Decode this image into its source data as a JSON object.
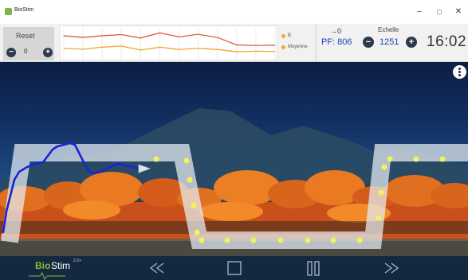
{
  "window": {
    "title": "BioStim",
    "minimize_glyph": "–",
    "maximize_glyph": "□",
    "close_glyph": "✕"
  },
  "reset": {
    "label": "Reset",
    "value": "0",
    "minus_glyph": "−",
    "plus_glyph": "+"
  },
  "chart_data": {
    "type": "line",
    "title": "",
    "xlabel": "",
    "ylabel": "",
    "grid": true,
    "ylim": [
      0,
      100
    ],
    "x": [
      0,
      1,
      2,
      3,
      4,
      5,
      6,
      7,
      8,
      9,
      10,
      11
    ],
    "series": [
      {
        "color": "#d9603b",
        "values": [
          78,
          72,
          78,
          82,
          70,
          88,
          74,
          83,
          72,
          46,
          44,
          45
        ]
      },
      {
        "color": "#f0a830",
        "values": [
          34,
          31,
          38,
          42,
          28,
          38,
          30,
          34,
          30,
          22,
          24,
          23
        ]
      }
    ]
  },
  "legend": {
    "items": [
      {
        "label": "B",
        "color": "#f0a830"
      },
      {
        "label": "Moyenne",
        "color": "#f0a830"
      }
    ]
  },
  "readout": {
    "arrow_value": "→0",
    "pf_value": "PF: 806"
  },
  "scale": {
    "label": "Echelle",
    "value": "1251",
    "minus_glyph": "−",
    "plus_glyph": "+"
  },
  "clock": "16:02",
  "bottombar": {
    "logo_bio": "Bio",
    "logo_stim": "Stim",
    "logo_version": "2.2+"
  },
  "icons": {
    "rewind": "rewind-icon",
    "stop": "stop-icon",
    "pause": "pause-icon",
    "forward": "fast-forward-icon",
    "menu": "vertical-dots-icon"
  },
  "colors": {
    "accent_blue": "#1e3fb0",
    "bar_dark": "#14283f",
    "logo_green": "#7ec03a",
    "trace_blue": "#1a22d8",
    "path_track": "#e6eef2",
    "target_dot": "#f4f25a"
  }
}
